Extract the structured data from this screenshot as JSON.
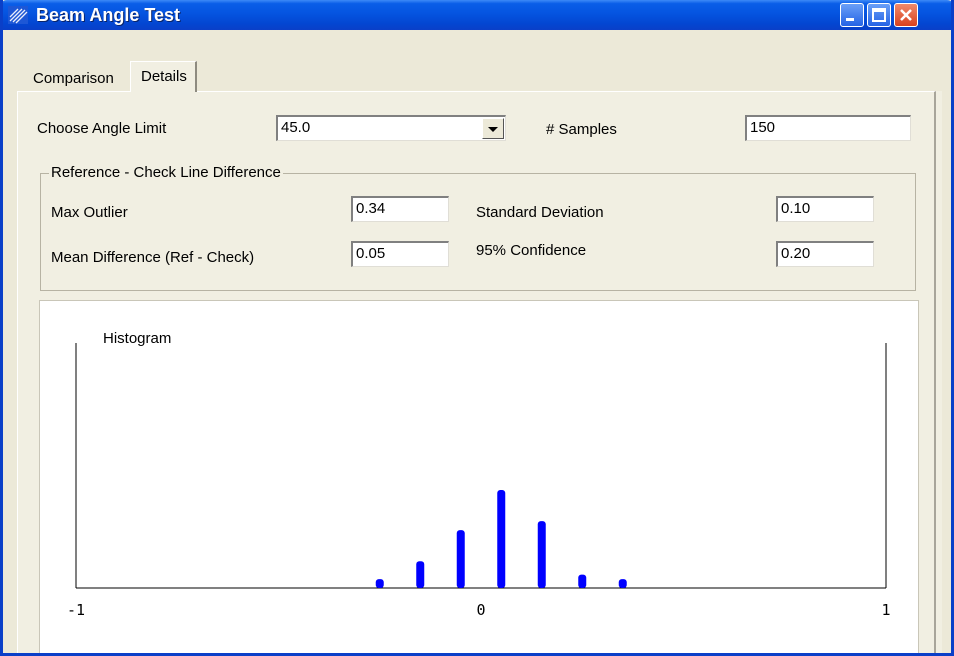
{
  "window": {
    "title": "Beam Angle Test",
    "controls": [
      "minimize-icon",
      "maximize-icon",
      "close-icon"
    ]
  },
  "tabs": [
    {
      "label": "Comparison",
      "selected": false
    },
    {
      "label": "Details",
      "selected": true
    }
  ],
  "angle_limit": {
    "label": "Choose Angle Limit",
    "value": "45.0"
  },
  "samples": {
    "label": "# Samples",
    "value": "150"
  },
  "group": {
    "title": "Reference - Check Line Difference",
    "max_outlier": {
      "label": "Max Outlier",
      "value": "0.34"
    },
    "mean_difference": {
      "label": "Mean Difference (Ref - Check)",
      "value": "0.05"
    },
    "std_dev": {
      "label": "Standard Deviation",
      "value": "0.10"
    },
    "confidence": {
      "label": "95% Confidence",
      "value": "0.20"
    }
  },
  "colors": {
    "bars": "#0000ff",
    "titlebar": "#0a5ee8"
  },
  "chart_data": {
    "type": "bar",
    "title": "Histogram",
    "xlim": [
      -1,
      1
    ],
    "xticks": [
      "-1",
      "0",
      "1"
    ],
    "x": [
      -0.25,
      -0.15,
      -0.05,
      0.05,
      0.15,
      0.25,
      0.35
    ],
    "values": [
      2,
      6,
      13,
      22,
      15,
      3,
      2
    ],
    "ylim": [
      0,
      22
    ]
  }
}
